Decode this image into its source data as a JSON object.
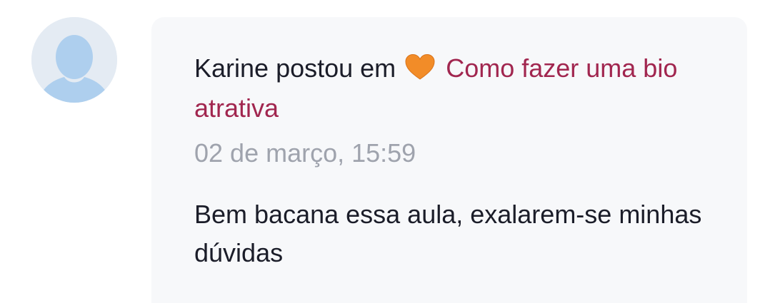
{
  "post": {
    "author_action": "Karine postou em",
    "emoji_icon": "orange-heart-icon",
    "link_text": "Como fazer uma bio atrativa",
    "timestamp": "02 de março, 15:59",
    "comment": "Bem bacana essa aula, exalarem-se minhas dúvidas"
  },
  "colors": {
    "link": "#a1264f",
    "text": "#1b1d29",
    "muted": "#9fa3ad",
    "card_background": "#f7f8fa",
    "heart": "#f28c28"
  }
}
